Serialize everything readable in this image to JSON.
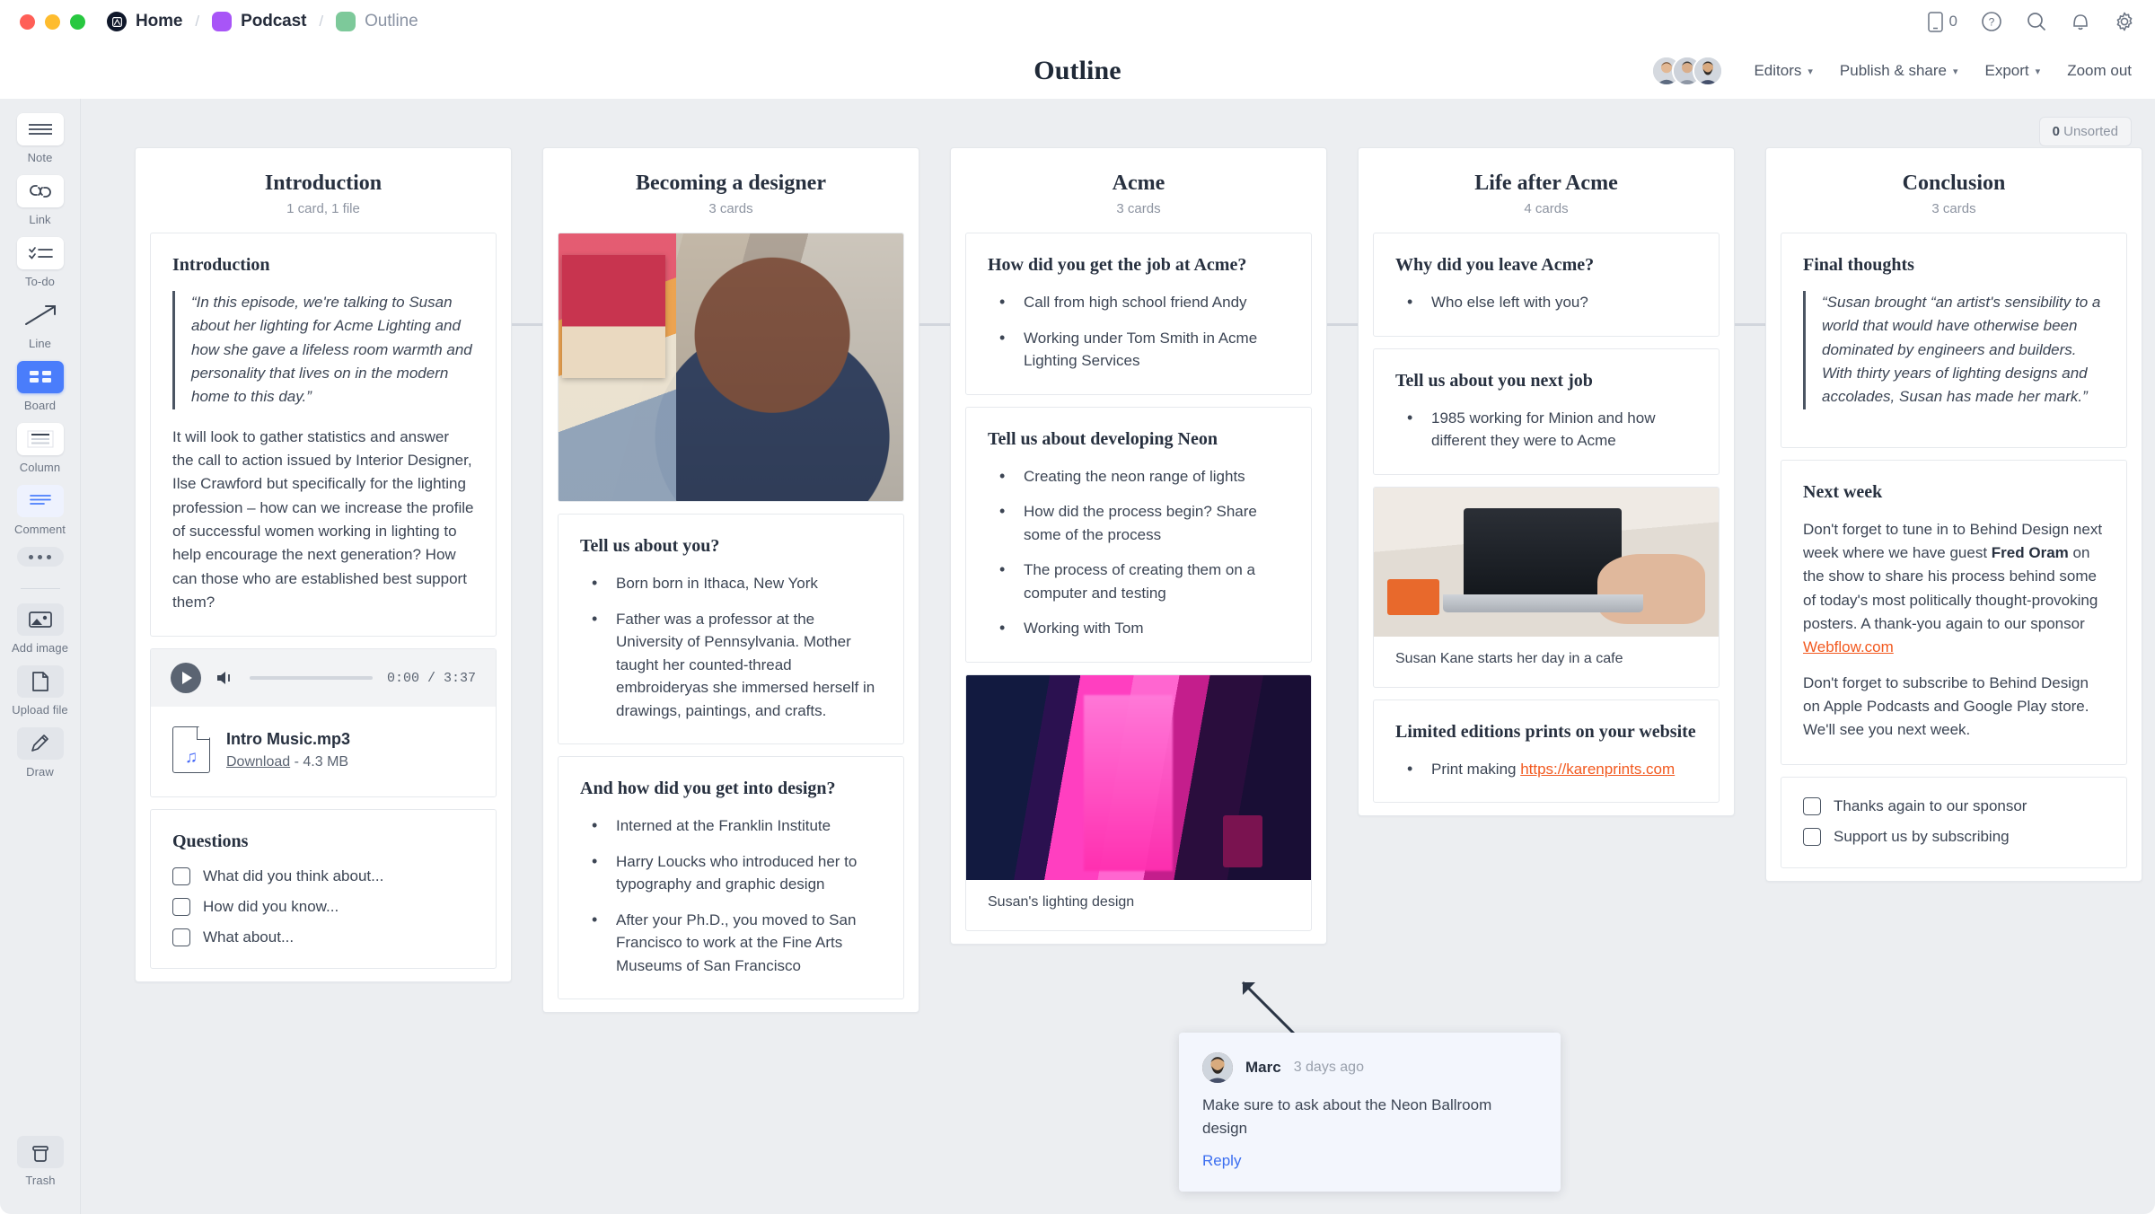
{
  "titlebar": {
    "breadcrumbs": [
      {
        "label": "Home",
        "icon": "milanote-logo-icon",
        "color": "#0f172a",
        "dim": false
      },
      {
        "label": "Podcast",
        "icon": "folder-swatch-icon",
        "color": "#a855f7",
        "dim": false
      },
      {
        "label": "Outline",
        "icon": "folder-swatch-icon",
        "color": "#7dc99a",
        "dim": true
      }
    ],
    "separator": "/",
    "right_icons": [
      {
        "name": "mobile-icon",
        "count": "0"
      },
      {
        "name": "help-icon"
      },
      {
        "name": "search-icon"
      },
      {
        "name": "notifications-bell-icon"
      },
      {
        "name": "settings-gear-icon"
      }
    ]
  },
  "header": {
    "title": "Outline",
    "actions": [
      {
        "label": "Editors",
        "has_caret": true
      },
      {
        "label": "Publish & share",
        "has_caret": true
      },
      {
        "label": "Export",
        "has_caret": true
      },
      {
        "label": "Zoom out",
        "has_caret": false
      }
    ],
    "avatar_count": 3
  },
  "toolbar": {
    "tools": [
      {
        "label": "Note",
        "icon": "note-icon",
        "style": "white",
        "active": false
      },
      {
        "label": "Link",
        "icon": "link-icon",
        "style": "white",
        "active": false
      },
      {
        "label": "To-do",
        "icon": "todo-icon",
        "style": "white",
        "active": false
      },
      {
        "label": "Line",
        "icon": "line-arrow-icon",
        "style": "none",
        "active": false
      },
      {
        "label": "Board",
        "icon": "board-icon",
        "style": "active",
        "active": true
      },
      {
        "label": "Column",
        "icon": "column-icon",
        "style": "white",
        "active": false
      },
      {
        "label": "Comment",
        "icon": "comment-icon",
        "style": "comment",
        "active": false
      }
    ],
    "more_label": "more-options",
    "uploads": [
      {
        "label": "Add image",
        "icon": "add-image-icon"
      },
      {
        "label": "Upload file",
        "icon": "upload-file-icon"
      },
      {
        "label": "Draw",
        "icon": "draw-pencil-icon"
      }
    ],
    "trash": {
      "label": "Trash",
      "icon": "trash-icon"
    }
  },
  "board": {
    "unsorted": {
      "count": "0",
      "label": "Unsorted"
    },
    "columns": [
      {
        "title": "Introduction",
        "subtitle": "1 card, 1 file",
        "cards": [
          {
            "type": "note",
            "title": "Introduction",
            "quote": "“In this episode, we're talking to Susan about her lighting for Acme Lighting and how she gave a lifeless room warmth and personality that lives on in the modern home to this day.”",
            "paragraphs": [
              "It will look to gather statistics and answer the call to action issued by Interior Designer, Ilse Crawford but specifically for the lighting profession – how can we increase the profile of successful women working in lighting to help encourage the next generation?  How can those who are established best support them?"
            ]
          },
          {
            "type": "audio",
            "time": "0:00 / 3:37",
            "file_name": "Intro Music.mp3",
            "download_label": "Download",
            "file_size": "4.3 MB",
            "separator": "-"
          },
          {
            "type": "todo",
            "title": "Questions",
            "items": [
              {
                "text": "What did you think about...",
                "checked": false
              },
              {
                "text": "How did you know...",
                "checked": false
              },
              {
                "text": "What about...",
                "checked": false
              }
            ]
          }
        ]
      },
      {
        "title": "Becoming a designer",
        "subtitle": "3 cards",
        "cards": [
          {
            "type": "image",
            "image": "designer-portrait-image",
            "caption": ""
          },
          {
            "type": "bullets",
            "title": "Tell us about you?",
            "items": [
              "Born born in Ithaca, New York",
              "Father was a professor at the University of Pennsylvania. Mother taught her counted-thread embroideryas she immersed herself in drawings, paintings, and crafts."
            ]
          },
          {
            "type": "bullets",
            "title": "And how did you get into design?",
            "items": [
              "Interned at the Franklin Institute",
              "Harry Loucks who introduced her to typography and graphic design",
              "After your Ph.D., you moved to San Francisco to work at the Fine Arts Museums of San Francisco"
            ]
          }
        ]
      },
      {
        "title": "Acme",
        "subtitle": "3 cards",
        "cards": [
          {
            "type": "bullets",
            "title": "How did you get the job at Acme?",
            "items": [
              "Call from high school friend Andy",
              "Working under Tom Smith in Acme Lighting Services"
            ]
          },
          {
            "type": "bullets",
            "title": "Tell us about developing Neon",
            "items": [
              "Creating the neon range of lights",
              "How did the process begin? Share some of the process",
              "The process of creating them on a computer and testing",
              "Working with Tom"
            ]
          },
          {
            "type": "image",
            "image": "neon-room-image",
            "caption": "Susan's lighting design"
          }
        ]
      },
      {
        "title": "Life after Acme",
        "subtitle": "4 cards",
        "cards": [
          {
            "type": "bullets",
            "title": "Why did you leave Acme?",
            "items": [
              "Who else left with you?"
            ]
          },
          {
            "type": "bullets",
            "title": "Tell us about you next job",
            "items": [
              "1985 working for Minion and how different they were to Acme"
            ]
          },
          {
            "type": "image",
            "image": "laptop-desk-image",
            "caption": "Susan Kane starts her day in a cafe"
          },
          {
            "type": "bullets",
            "title": "Limited editions prints on your website",
            "items": [
              "Print making https://karenprints.com"
            ],
            "link_text": "https://karenprints.com"
          }
        ]
      },
      {
        "title": "Conclusion",
        "subtitle": "3 cards",
        "cards": [
          {
            "type": "note",
            "title": "Final thoughts",
            "quote": "“Susan brought “an artist's sensibility to a world that would have otherwise been dominated by engineers and builders. With thirty years of lighting designs and accolades, Susan has made her mark.”",
            "paragraphs": []
          },
          {
            "type": "note",
            "title": "Next week",
            "quote": "",
            "paragraphs": [
              "Don't forget to tune in to Behind Design next week where we have guest Fred Oram on the show to share his process behind some of today's most politically thought-provoking posters. A  thank-you again to our sponsor Webflow.com",
              "Don't forget to subscribe to Behind Design on Apple Podcasts and Google Play store. We'll see you next week."
            ],
            "bold_text": "Fred Oram",
            "link_text": "Webflow.com"
          },
          {
            "type": "todo",
            "title": "",
            "items": [
              {
                "text": "Thanks again to our sponsor",
                "checked": false
              },
              {
                "text": "Support us by subscribing",
                "checked": false
              }
            ]
          }
        ]
      }
    ]
  },
  "comment": {
    "author": "Marc",
    "time": "3 days ago",
    "body": "Make sure to ask about the Neon Ballroom design",
    "reply_label": "Reply"
  },
  "colors": {
    "accent_blue": "#4a7dfb",
    "link_orange": "#f2591f",
    "reply_blue": "#3b6ef0",
    "board_bg": "#eceef1",
    "text": "#3c4554"
  }
}
